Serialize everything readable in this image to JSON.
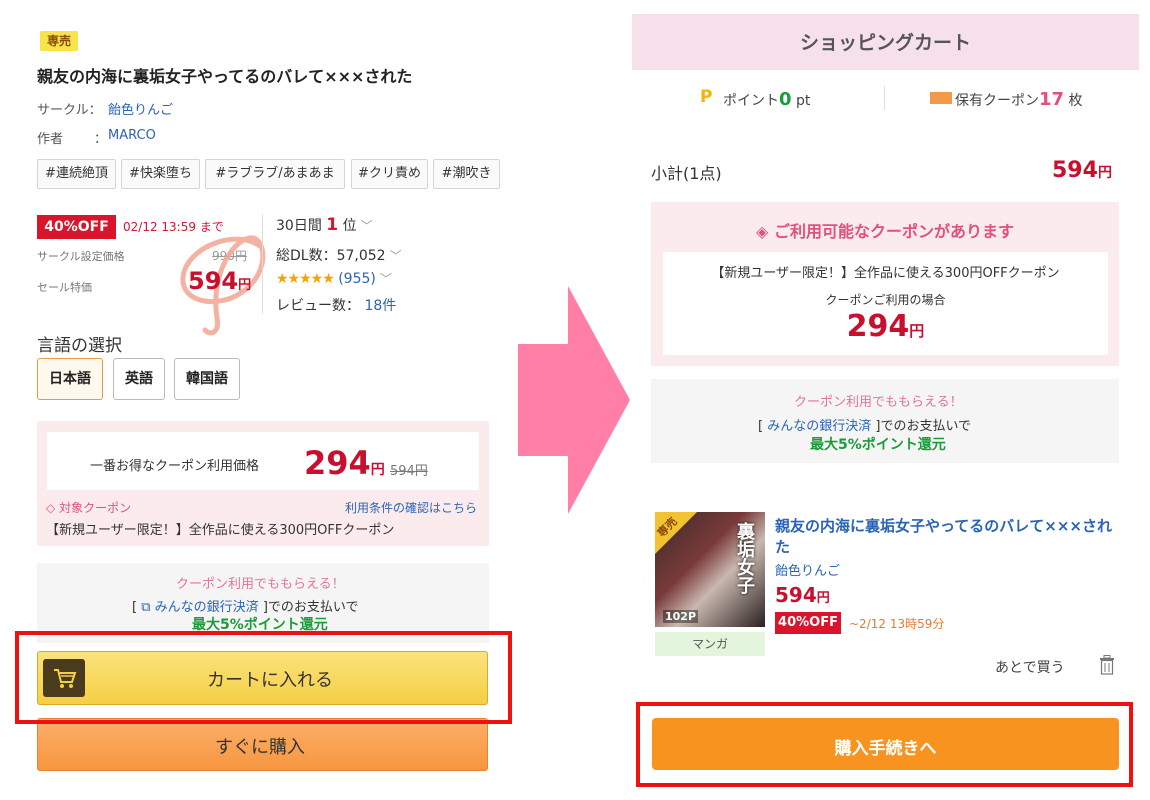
{
  "left": {
    "badge": "専売",
    "title": "親友の内海に裏垢女子やってるのバレて×××された",
    "circle_label": "サークル：",
    "circle_name": "飴色りんご",
    "author_label": "作者",
    "author_sep": "：",
    "author_name": "MARCO",
    "tags": [
      "#連続絶頂",
      "#快楽堕ち",
      "#ラブラブ/あまあま",
      "#クリ責め",
      "#潮吹き"
    ],
    "discount_badge": "40%OFF",
    "deadline": "02/12 13:59 まで",
    "circle_price_label": "サークル設定価格",
    "circle_price": "990円",
    "sale_price_label": "セール特価",
    "sale_price": "594",
    "yen": "円",
    "rank_prefix": "30日間",
    "rank_value": "1",
    "rank_suffix": "位",
    "downloads": "総DL数：57,052",
    "stars": "★★★★★",
    "rating_count": "(955)",
    "reviews_label": "レビュー数：",
    "reviews_value": "18件",
    "language_heading": "言語の選択",
    "languages": [
      "日本語",
      "英語",
      "韓国語"
    ],
    "best_coupon_label": "一番お得なクーポン利用価格",
    "best_coupon_price": "294",
    "best_coupon_original": "594円",
    "target_coupon": "対象クーポン",
    "terms_link": "利用条件の確認はこちら",
    "coupon_desc": "【新規ユーザー限定！】全作品に使える300円OFFクーポン",
    "bank_promo": "クーポン利用でももらえる！",
    "bank_open": "[",
    "bank_name": "みんなの銀行決済",
    "bank_close": "]でのお支払いで",
    "bank_reward": "最大5%ポイント還元",
    "cart_button": "カートに入れる",
    "buy_button": "すぐに購入"
  },
  "right": {
    "header": "ショッピングカート",
    "point_label": "ポイント",
    "point_value": "0",
    "point_unit": "pt",
    "coupon_label": "保有クーポン",
    "coupon_value": "17",
    "coupon_unit": "枚",
    "subtotal_label": "小計(1点)",
    "subtotal_value": "594",
    "yen": "円",
    "coupon_available": "ご利用可能なクーポンがあります",
    "coupon_desc": "【新規ユーザー限定！】全作品に使える300円OFFクーポン",
    "coupon_when": "クーポンご利用の場合",
    "coupon_price": "294",
    "bank_promo": "クーポン利用でももらえる！",
    "bank_line_open": "[",
    "bank_name": "みんなの銀行決済",
    "bank_line_close": "]でのお支払いで",
    "bank_reward": "最大5%ポイント還元",
    "thumb_corner": "専売",
    "thumb_title": "裏垢女子",
    "thumb_pages": "102P",
    "item_genre": "マンガ",
    "item_title": "親友の内海に裏垢女子やってるのバレて×××された",
    "item_circle": "飴色りんご",
    "item_price": "594",
    "item_off": "40%OFF",
    "item_deadline": "~2/12 13時59分",
    "later_button": "あとで買う",
    "proceed_button": "購入手続きへ"
  },
  "colors": {
    "accent_red": "#c8102e",
    "cart_yellow": "#f5cf44",
    "buy_orange": "#f7963f",
    "proceed_orange": "#f7931e",
    "highlight_frame": "#ee1111",
    "arrow_pink": "#ff7fa6"
  }
}
